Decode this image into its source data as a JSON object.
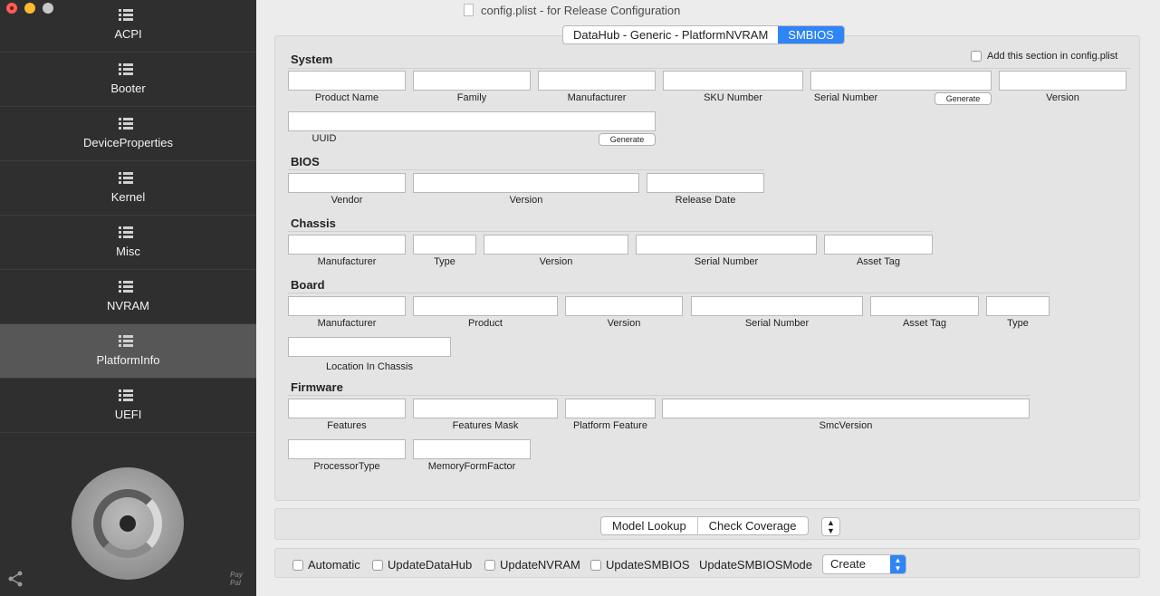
{
  "window": {
    "title": "config.plist - for Release Configuration"
  },
  "sidebar": {
    "items": [
      {
        "label": "ACPI"
      },
      {
        "label": "Booter"
      },
      {
        "label": "DeviceProperties"
      },
      {
        "label": "Kernel"
      },
      {
        "label": "Misc"
      },
      {
        "label": "NVRAM"
      },
      {
        "label": "PlatformInfo",
        "active": true
      },
      {
        "label": "UEFI"
      }
    ],
    "paypal": "Pay\nPal"
  },
  "tabs": [
    {
      "label": "DataHub - Generic - PlatformNVRAM"
    },
    {
      "label": "SMBIOS",
      "selected": true
    }
  ],
  "add_section_label": "Add this section in config.plist",
  "sections": {
    "system": {
      "title": "System",
      "fields": [
        "Product Name",
        "Family",
        "Manufacturer",
        "SKU Number",
        "Serial Number",
        "Version",
        "UUID"
      ],
      "generate_label": "Generate"
    },
    "bios": {
      "title": "BIOS",
      "fields": [
        "Vendor",
        "Version",
        "Release Date"
      ]
    },
    "chassis": {
      "title": "Chassis",
      "fields": [
        "Manufacturer",
        "Type",
        "Version",
        "Serial Number",
        "Asset Tag"
      ]
    },
    "board": {
      "title": "Board",
      "fields": [
        "Manufacturer",
        "Product",
        "Version",
        "Serial Number",
        "Asset Tag",
        "Type",
        "Location In Chassis"
      ]
    },
    "firmware": {
      "title": "Firmware",
      "fields": [
        "Features",
        "Features Mask",
        "Platform Feature",
        "SmcVersion",
        "ProcessorType",
        "MemoryFormFactor"
      ]
    }
  },
  "lookup": {
    "model_lookup": "Model Lookup",
    "check_coverage": "Check Coverage"
  },
  "options": {
    "automatic": "Automatic",
    "update_datahub": "UpdateDataHub",
    "update_nvram": "UpdateNVRAM",
    "update_smbios": "UpdateSMBIOS",
    "update_smbios_mode_label": "UpdateSMBIOSMode",
    "update_smbios_mode_value": "Create"
  }
}
